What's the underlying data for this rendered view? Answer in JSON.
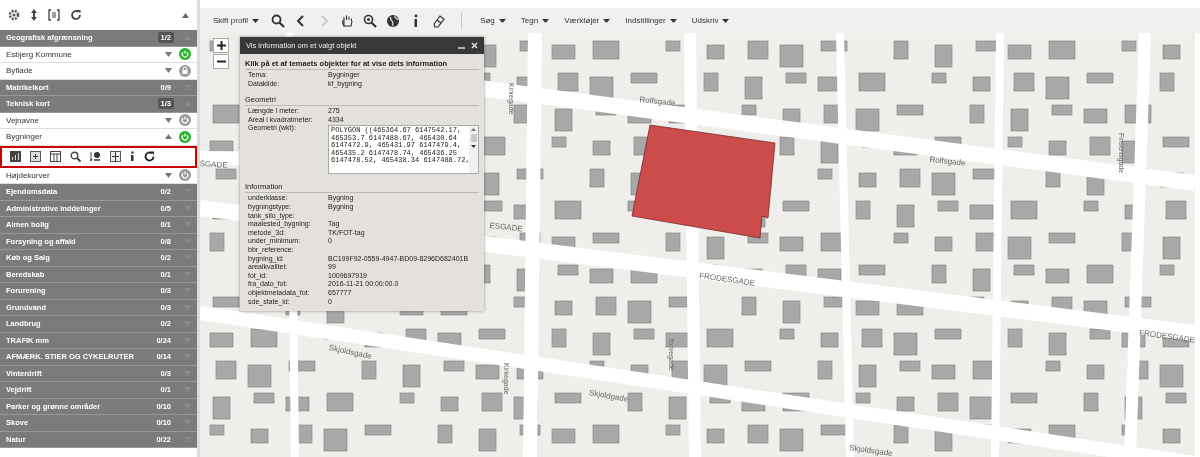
{
  "sidebar": {
    "groups": [
      {
        "label": "Geografisk afgrænsning",
        "count": "1/2",
        "expanded": true,
        "layers": [
          {
            "label": "Esbjerg Kommune",
            "kind": "toggle",
            "on": true,
            "expanded": false
          },
          {
            "label": "Byflade",
            "kind": "locked",
            "expanded": false
          }
        ]
      },
      {
        "label": "Matrikelkort",
        "count": "0/9",
        "expanded": false
      },
      {
        "label": "Teknisk kort",
        "count": "1/3",
        "expanded": true,
        "layers": [
          {
            "label": "Vejnavne",
            "kind": "toggle",
            "on": false,
            "expanded": false
          },
          {
            "label": "Bygninger",
            "kind": "toggle",
            "on": true,
            "expanded": true
          },
          {
            "label": "Højdekurver",
            "kind": "toggle",
            "on": false,
            "expanded": false
          }
        ]
      },
      {
        "label": "Ejendomsdata",
        "count": "0/2",
        "expanded": false
      },
      {
        "label": "Administrative inddelinger",
        "count": "0/5",
        "expanded": false
      },
      {
        "label": "Almen bolig",
        "count": "0/1",
        "expanded": false
      },
      {
        "label": "Forsyning og affald",
        "count": "0/8",
        "expanded": false
      },
      {
        "label": "Køb og Salg",
        "count": "0/2",
        "expanded": false
      },
      {
        "label": "Beredskab",
        "count": "0/1",
        "expanded": false
      },
      {
        "label": "Forurening",
        "count": "0/3",
        "expanded": false
      },
      {
        "label": "Grundvand",
        "count": "0/3",
        "expanded": false
      },
      {
        "label": "Landbrug",
        "count": "0/2",
        "expanded": false
      },
      {
        "label": "TRAFIK mm",
        "count": "0/24",
        "expanded": false
      },
      {
        "label": "AFMÆRK. STIER OG CYKELRUTER",
        "count": "0/14",
        "expanded": false
      },
      {
        "label": "Vinterdrift",
        "count": "0/3",
        "expanded": false
      },
      {
        "label": "Vejdrift",
        "count": "0/1",
        "expanded": false
      },
      {
        "label": "Parker og grønne områder",
        "count": "0/10",
        "expanded": false
      },
      {
        "label": "Skove",
        "count": "0/10",
        "expanded": false
      },
      {
        "label": "Natur",
        "count": "0/22",
        "expanded": false
      }
    ]
  },
  "toolbar": {
    "profile": "Skift profil",
    "tools": [
      {
        "disabled": false
      },
      {
        "disabled": false
      },
      {
        "disabled": true
      },
      {
        "disabled": false
      },
      {
        "disabled": false
      },
      {
        "disabled": false
      },
      {
        "disabled": false
      },
      {
        "disabled": false
      }
    ],
    "menus": [
      "Søg",
      "Tegn",
      "Værktøjer",
      "Indstillinger",
      "Udskriv"
    ]
  },
  "map": {
    "labels": [
      {
        "text": "Rolfsgade",
        "kind": "h"
      },
      {
        "text": "Rolfsgade",
        "kind": "h"
      },
      {
        "text": "SGADE",
        "kind": "h"
      },
      {
        "text": "ESGADE",
        "kind": "h"
      },
      {
        "text": "FRODESGADE",
        "kind": "h"
      },
      {
        "text": "FRODESGADE",
        "kind": "h"
      },
      {
        "text": "Skjoldsgade",
        "kind": "h"
      },
      {
        "text": "Skjoldgade",
        "kind": "h"
      },
      {
        "text": "Skjoldsgade",
        "kind": "h"
      },
      {
        "text": "Kirkegade",
        "kind": "v"
      },
      {
        "text": "Kirkegade",
        "kind": "v"
      },
      {
        "text": "Torvegade",
        "kind": "v"
      },
      {
        "text": "Finsensgade",
        "kind": "v"
      }
    ]
  },
  "popup": {
    "title": "Vis information om et valgt objekt",
    "instruction": "Klik på et af temaets objekter for at vise dets information",
    "sections": [
      {
        "rows": [
          {
            "label": "Tema:",
            "value": "Bygninger"
          },
          {
            "label": "Datakilde:",
            "value": "kf_bygning"
          }
        ]
      },
      {
        "heading": "Geometri",
        "rows": [
          {
            "label": "Længde i meter:",
            "value": "275"
          },
          {
            "label": "Areal i kvadratmeter:",
            "value": "4334"
          },
          {
            "label": "Geometri (wkt):",
            "kind": "textarea",
            "value": "POLYGON ((465364.67 6147542.17,\n465353.7 6147488.67, 465430.64\n6147472.9, 465431.97 6147479.4,\n465435.2 6147478.74, 465436.25\n6147478.52, 465438.34 6147488.72,"
          }
        ]
      },
      {
        "heading": "Information",
        "rows": [
          {
            "label": "underklasse:",
            "value": "Bygning"
          },
          {
            "label": "bygningstype:",
            "value": "Bygning"
          },
          {
            "label": "tank_silo_type:"
          },
          {
            "label": "maalested_bygning:",
            "value": "Tag"
          },
          {
            "label": "metode_3d:",
            "value": "TK/FOT-tag"
          },
          {
            "label": "under_minimum:",
            "value": "0"
          },
          {
            "label": "bbr_reference:"
          },
          {
            "label": "bygning_id:",
            "value": "BC199F92-0559-4947-BD09-8296D682401B"
          },
          {
            "label": "arealkvalitet:",
            "value": "99"
          },
          {
            "label": "fot_id:",
            "value": "1009697919"
          },
          {
            "label": "fra_dato_fot:",
            "value": "2016-11-21 00:00:00.0"
          },
          {
            "label": "objektmetadata_fot:",
            "value": "657777"
          },
          {
            "label": "sde_state_id:",
            "value": "0"
          }
        ]
      }
    ]
  }
}
